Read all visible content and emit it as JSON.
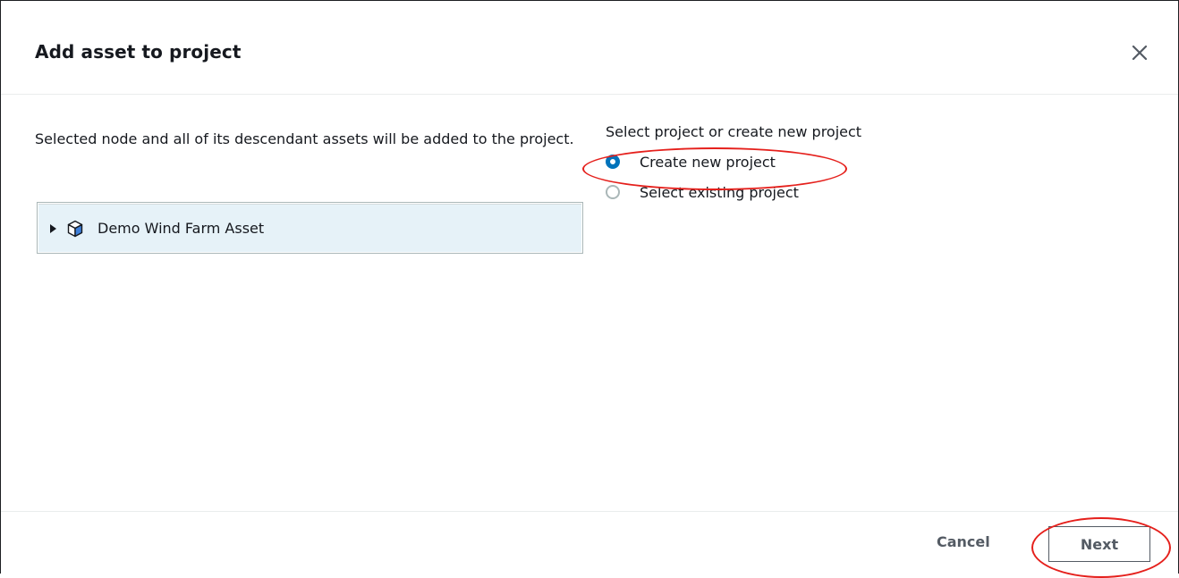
{
  "modal": {
    "title": "Add asset to project",
    "close_icon": "close-icon"
  },
  "left": {
    "description": "Selected node and all of its descendant assets will be added to the project.",
    "tree": {
      "items": [
        {
          "label": "Demo Wind Farm Asset",
          "icon": "cube-icon",
          "expanded": false,
          "selected": true
        }
      ]
    }
  },
  "right": {
    "section_label": "Select project or create new project",
    "options": [
      {
        "label": "Create new project",
        "checked": true
      },
      {
        "label": "Select existing project",
        "checked": false
      }
    ]
  },
  "footer": {
    "cancel_label": "Cancel",
    "next_label": "Next"
  },
  "colors": {
    "accent": "#0073bb",
    "annotation": "#e5201c",
    "selected_row": "#e6f2f8"
  }
}
